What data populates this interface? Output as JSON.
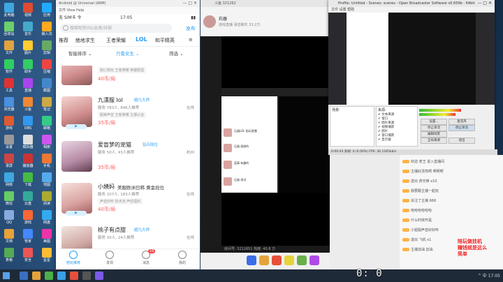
{
  "colors": {
    "accent": "#2a9df4",
    "price": "#ff5b5b"
  },
  "emulator": {
    "title": "Android @ Universal (ARM)",
    "menu": "文件  View  Help",
    "status": {
      "carrier": "无 SIM卡 令",
      "time": "17:05",
      "battery": "▮▮"
    },
    "search_placeholder": "搜索昵称/ID/品类/技能",
    "publish": "发布",
    "categories": [
      "推荐",
      "绝地求生",
      "王者荣耀",
      "LOL",
      "和平精英",
      "≡"
    ],
    "filter": {
      "sort": "智能排序 ⌄",
      "only": "只看女生 ⌄",
      "screen": "筛选 ⌄"
    },
    "cards": [
      {
        "name": "",
        "tag": "",
        "info": "甜心陪玩 王者荣耀 英雄联盟",
        "loc": "",
        "chips": "",
        "price": "40币/局"
      },
      {
        "name": "九漂服 lol",
        "tag": "超凡大师",
        "info": "服务 783人, 846人推荐",
        "loc": "在线",
        "chips": "甜美声音  王者荣耀  主播认证",
        "price": "35币/局"
      },
      {
        "name": "爱盲梦的宠猫",
        "tag": "钻石段位",
        "info": "服务 50人, 43人推荐",
        "loc": "杭州",
        "chips": "",
        "price": "35币/局"
      },
      {
        "name": "小姨妈",
        "tag": "美服欧洲日韩  黄金段位",
        "info": "服务 207人, 183人推荐",
        "loc": "在线",
        "chips": "声音好听  技术流  声控福利",
        "price": "40币/局"
      },
      {
        "name": "桃子有点甜",
        "tag": "超凡大师",
        "info": "服务 30人, 24人推荐",
        "loc": "在线",
        "chips": "",
        "price": ""
      }
    ],
    "tabs": [
      {
        "label": "陪玩推荐",
        "active": true
      },
      {
        "label": "发现"
      },
      {
        "label": "消息",
        "badge": "16"
      },
      {
        "label": "我的"
      }
    ]
  },
  "stream": {
    "tab": "斗鱼  321262",
    "room_name": "石器",
    "room_sub": "游戏直播 语音聊天 33.2万",
    "bottom_bar": "房间号: 3212651  热度: 40.8 万",
    "nested_rows": [
      "石器LOL 陪玩直播",
      "石器 甜甜的",
      "蓝莓 有趣的",
      "石器 测试"
    ]
  },
  "obs": {
    "title": "Profile: Untitled - Scenes: scenes - Open Broadcaster Software v0.659b - 64bit",
    "menu": "文件  设置  帮助",
    "dock": {
      "scenes_header": "场景:",
      "sources_header": "来源:",
      "sources": [
        "✔ 文本来源",
        "✔ 窗口",
        "✔ 图片来源",
        "✔ 视频捕获",
        "✔ 图片",
        "✔ 窗口捕获",
        "✔ 显示器"
      ],
      "buttons": [
        "设置...",
        "停止串流",
        "编辑场景",
        "全局来源",
        "退出"
      ],
      "right_buttons": [
        "麦克风",
        "停止串流"
      ]
    },
    "status": "0:00:43  丢帧: 0 (0.00%)  FPS: 30   1265kb/s"
  },
  "chat": {
    "messages": [
      "欢迎 老王 进入直播间",
      "主播好漂亮啊 啊啊啊",
      "送出 荧光棒 x10",
      "我要跟主播一起玩",
      "关注了主播 666",
      "哈哈哈哈哈哈",
      "什么时候开黑",
      "小姐姐声音好好听",
      "送出 飞机 x1",
      "主播加油 加油"
    ],
    "overlay": [
      "陪玩做挂机",
      "赚钱就是这么",
      "简单"
    ]
  },
  "timer": "0: 0",
  "taskbar": {
    "tray": "^ 中 17:05"
  }
}
